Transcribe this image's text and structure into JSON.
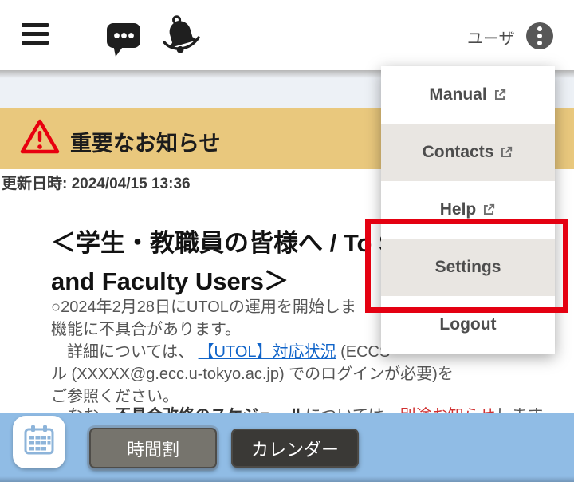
{
  "header": {
    "user_label": "ユーザ"
  },
  "menu": {
    "items": [
      {
        "label": "Manual",
        "external": true,
        "highlighted": false
      },
      {
        "label": "Contacts",
        "external": true,
        "highlighted": true
      },
      {
        "label": "Help",
        "external": true,
        "highlighted": false
      },
      {
        "label": "Settings",
        "external": false,
        "highlighted": true,
        "annotated": true
      },
      {
        "label": "Logout",
        "external": false,
        "highlighted": false
      }
    ]
  },
  "notice_banner": {
    "title": "重要なお知らせ"
  },
  "updated_text": "更新日時: 2024/04/15 13:36",
  "article": {
    "heading_line1": "＜学生・教職員の皆様へ / To S",
    "heading_line2": "and Faculty Users＞",
    "p1": "○2024年2月28日にUTOLの運用を開始しま",
    "p2": "機能に不具合があります。",
    "p3_pre": "　詳細については、 ",
    "p3_link": "【UTOL】対応状況",
    "p3_post": " (ECCS",
    "p4": "ル (XXXXX@g.ecc.u-tokyo.ac.jp) でのログインが必要)を",
    "p5": "ご参照ください。",
    "p6_pre": "　なお、",
    "p6_bold": "不具合改修のスケジュール",
    "p6_mid": "については、",
    "p6_red": "別途お知らせ",
    "p6_post": "します。"
  },
  "bottom_bar": {
    "timetable_label": "時間割",
    "calendar_label": "カレンダー"
  },
  "colors": {
    "banner_yellow": "#e9c87d",
    "annotation_red": "#e40011",
    "link_blue": "#1064c9",
    "bottom_bar_blue": "#90bce5",
    "menu_highlight": "#e9e6e2",
    "body_text": "#555555"
  }
}
